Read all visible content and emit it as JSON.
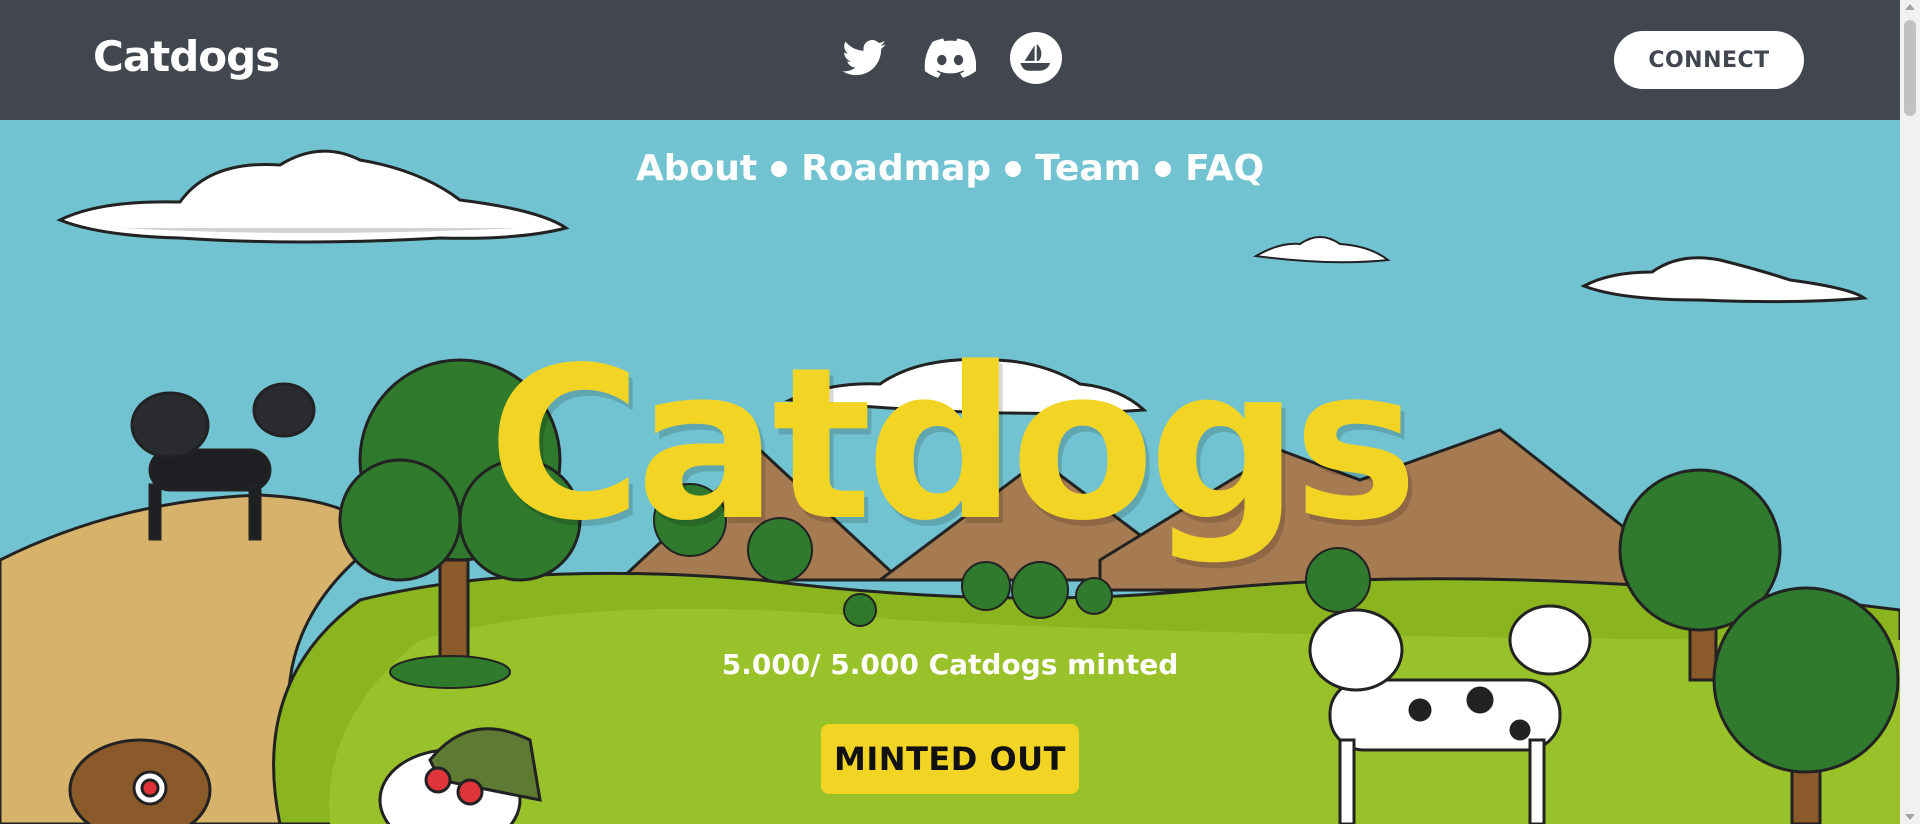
{
  "header": {
    "logo": "Catdogs",
    "connect_label": "CONNECT",
    "socials": [
      {
        "icon": "twitter-icon"
      },
      {
        "icon": "discord-icon"
      },
      {
        "icon": "opensea-icon"
      }
    ]
  },
  "nav": {
    "items": [
      "About",
      "Roadmap",
      "Team",
      "FAQ"
    ]
  },
  "hero": {
    "title": "Catdogs",
    "minted_text": "5.000/ 5.000 Catdogs minted",
    "button_label": "MINTED OUT"
  },
  "colors": {
    "header_bg": "#41464f",
    "sky": "#71c3d1",
    "accent_yellow": "#f2d524",
    "grass": "#8ab51f",
    "dirt": "#d6b26a"
  }
}
